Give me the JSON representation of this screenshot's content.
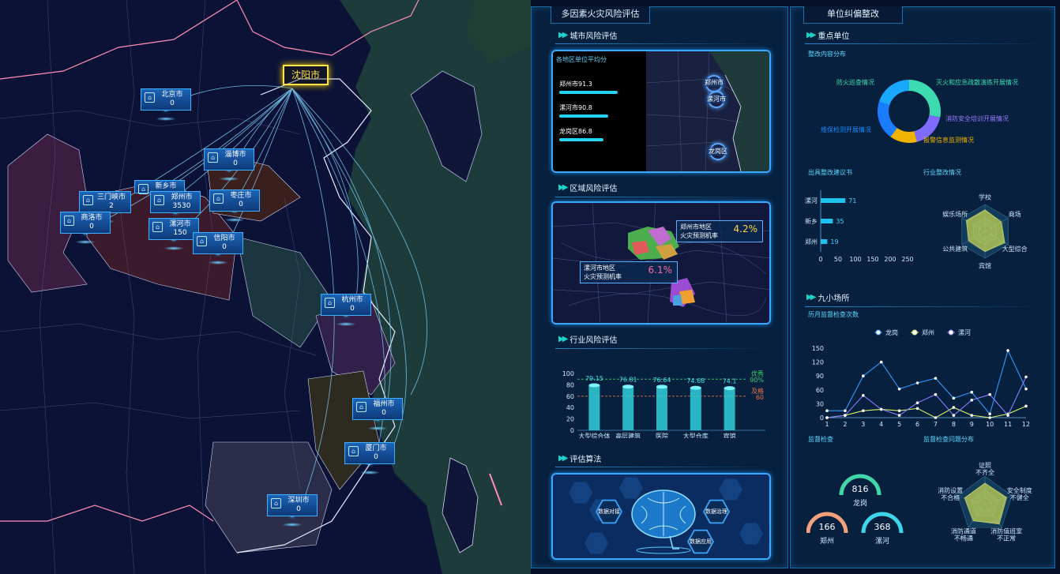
{
  "map": {
    "origin": "沈阳市",
    "cities": [
      {
        "name": "北京市",
        "value": "0"
      },
      {
        "name": "淄博市",
        "value": "0"
      },
      {
        "name": "新乡市",
        "value": ""
      },
      {
        "name": "三门峡市",
        "value": "2"
      },
      {
        "name": "郑州市",
        "value": "3530"
      },
      {
        "name": "枣庄市",
        "value": "0"
      },
      {
        "name": "商洛市",
        "value": "0"
      },
      {
        "name": "漯河市",
        "value": "150"
      },
      {
        "name": "信阳市",
        "value": "0"
      },
      {
        "name": "杭州市",
        "value": "0"
      },
      {
        "name": "福州市",
        "value": "0"
      },
      {
        "name": "厦门市",
        "value": "0"
      },
      {
        "name": "深圳市",
        "value": "0"
      }
    ]
  },
  "left_panel": {
    "title": "多因素火灾风险评估",
    "city_risk": {
      "title": "城市风险评估",
      "subtitle": "各地区单位平均分",
      "bars": [
        {
          "label": "郑州市91.3",
          "value": 91.3
        },
        {
          "label": "漯河市90.8",
          "value": 90.8
        },
        {
          "label": "龙岗区86.8",
          "value": 86.8
        }
      ],
      "pins": [
        "郑州市",
        "漯河市",
        "龙岗区"
      ]
    },
    "area_risk": {
      "title": "区域风险评估",
      "tag1_label": "郑州市地区",
      "tag1_sub": "火灾预测机率",
      "tag1_pct": "4.2%",
      "tag2_label": "漯河市地区",
      "tag2_sub": "火灾预测机率",
      "tag2_pct": "6.1%"
    },
    "industry_risk": {
      "title": "行业风险评估"
    },
    "algorithm": {
      "title": "评估算法",
      "btn1": "数据对接",
      "btn2": "数据治理",
      "btn3": "数据应用"
    }
  },
  "right_panel": {
    "title": "单位纠偏整改",
    "key_units": {
      "title": "重点单位",
      "donut_title": "整改内容分布",
      "donut_labels": [
        "防火巡查情况",
        "灭火和应急疏散演练开展情况",
        "消防安全培训开展情况",
        "报警信息监测情况",
        "维保检测开展情况"
      ],
      "donut_colors": [
        "#3ddcb0",
        "#7e6bff",
        "#f0b400",
        "#1a7cff",
        "#1aa8ff"
      ],
      "donut_values": [
        28,
        18,
        14,
        20,
        20
      ],
      "rectify_title": "出具整改建议书",
      "industry_title": "行业整改情况",
      "radar1_labels": [
        "学校",
        "商场",
        "大型综合",
        "宾馆",
        "公共建筑",
        "娱乐场所"
      ]
    },
    "nine_small": {
      "title": "九小场所",
      "line_title": "历月监督检查次数",
      "inspect_title": "监督检查",
      "problem_title": "监督检查问题分布",
      "gauges": [
        {
          "value": "816",
          "name": "龙岗",
          "color": "#41d7a8"
        },
        {
          "value": "166",
          "name": "郑州",
          "color": "#f4a07a"
        },
        {
          "value": "368",
          "name": "漯河",
          "color": "#3fd5e8"
        }
      ],
      "radar2_labels": [
        "证照\n不齐全",
        "安全制度\n不健全",
        "消防值班室\n不正常",
        "消防通道\n不畅通",
        "消防设置\n不合格"
      ]
    }
  },
  "chart_data": [
    {
      "type": "bar",
      "title": "",
      "categories": [
        "大型综合体",
        "高层建筑",
        "医院",
        "大型仓库",
        "宾馆"
      ],
      "values": [
        79.15,
        76.81,
        76.64,
        74.68,
        74.1
      ],
      "ylim": [
        0,
        100
      ],
      "yticks": [
        0,
        20,
        40,
        60,
        80,
        100
      ],
      "reference_lines": [
        {
          "label": "优秀",
          "value_label": "90%",
          "value": 90,
          "color": "#39d26b"
        },
        {
          "label": "及格",
          "value_label": "60",
          "value": 60,
          "color": "#e8734e"
        }
      ]
    },
    {
      "type": "bar",
      "orientation": "horizontal",
      "title": "出具整改建议书",
      "categories": [
        "漯河",
        "新乡",
        "郑州"
      ],
      "values": [
        71,
        35,
        19
      ],
      "xlim": [
        0,
        250
      ],
      "xticks": [
        0,
        50,
        100,
        150,
        200,
        250
      ]
    },
    {
      "type": "line",
      "title": "历月监督检查次数",
      "x": [
        1,
        2,
        3,
        4,
        5,
        6,
        7,
        8,
        9,
        10,
        11,
        12
      ],
      "ylim": [
        0,
        150
      ],
      "yticks": [
        0,
        30,
        60,
        90,
        120,
        150
      ],
      "legend": "top",
      "series": [
        {
          "name": "龙岗",
          "color": "#2e9bff",
          "values": [
            15,
            15,
            90,
            120,
            62,
            75,
            85,
            42,
            55,
            8,
            145,
            62
          ]
        },
        {
          "name": "郑州",
          "color": "#d7f06a",
          "values": [
            0,
            5,
            15,
            18,
            15,
            20,
            0,
            22,
            5,
            0,
            8,
            25
          ]
        },
        {
          "name": "漯河",
          "color": "#8a7dff",
          "values": [
            0,
            5,
            48,
            18,
            5,
            32,
            50,
            5,
            38,
            50,
            5,
            88
          ]
        }
      ]
    },
    {
      "type": "radar",
      "title": "行业整改情况",
      "axes": [
        "学校",
        "商场",
        "大型综合",
        "宾馆",
        "公共建筑",
        "娱乐场所"
      ],
      "values": [
        0.8,
        0.7,
        0.85,
        0.75,
        0.7,
        0.8
      ]
    },
    {
      "type": "radar",
      "title": "监督检查问题分布",
      "axes": [
        "证照不齐全",
        "安全制度不健全",
        "消防值班室不正常",
        "消防通道不畅通",
        "消防设置不合格"
      ],
      "values": [
        0.75,
        0.8,
        0.85,
        0.7,
        0.75
      ]
    }
  ]
}
